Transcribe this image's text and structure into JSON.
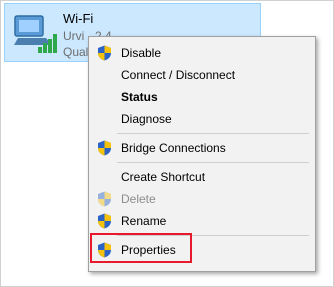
{
  "adapter": {
    "name": "Wi-Fi",
    "subtitle": "Urvi - 2.4",
    "subtitle2": "Qual"
  },
  "context_menu": {
    "items": [
      {
        "label": "Disable"
      },
      {
        "label": "Connect / Disconnect"
      },
      {
        "label": "Status"
      },
      {
        "label": "Diagnose"
      },
      {
        "label": "Bridge Connections"
      },
      {
        "label": "Create Shortcut"
      },
      {
        "label": "Delete"
      },
      {
        "label": "Rename"
      },
      {
        "label": "Properties"
      }
    ]
  },
  "colors": {
    "selection_bg": "#cce8ff",
    "highlight_border": "#e8182d",
    "menu_bg": "#f2f2f2"
  }
}
